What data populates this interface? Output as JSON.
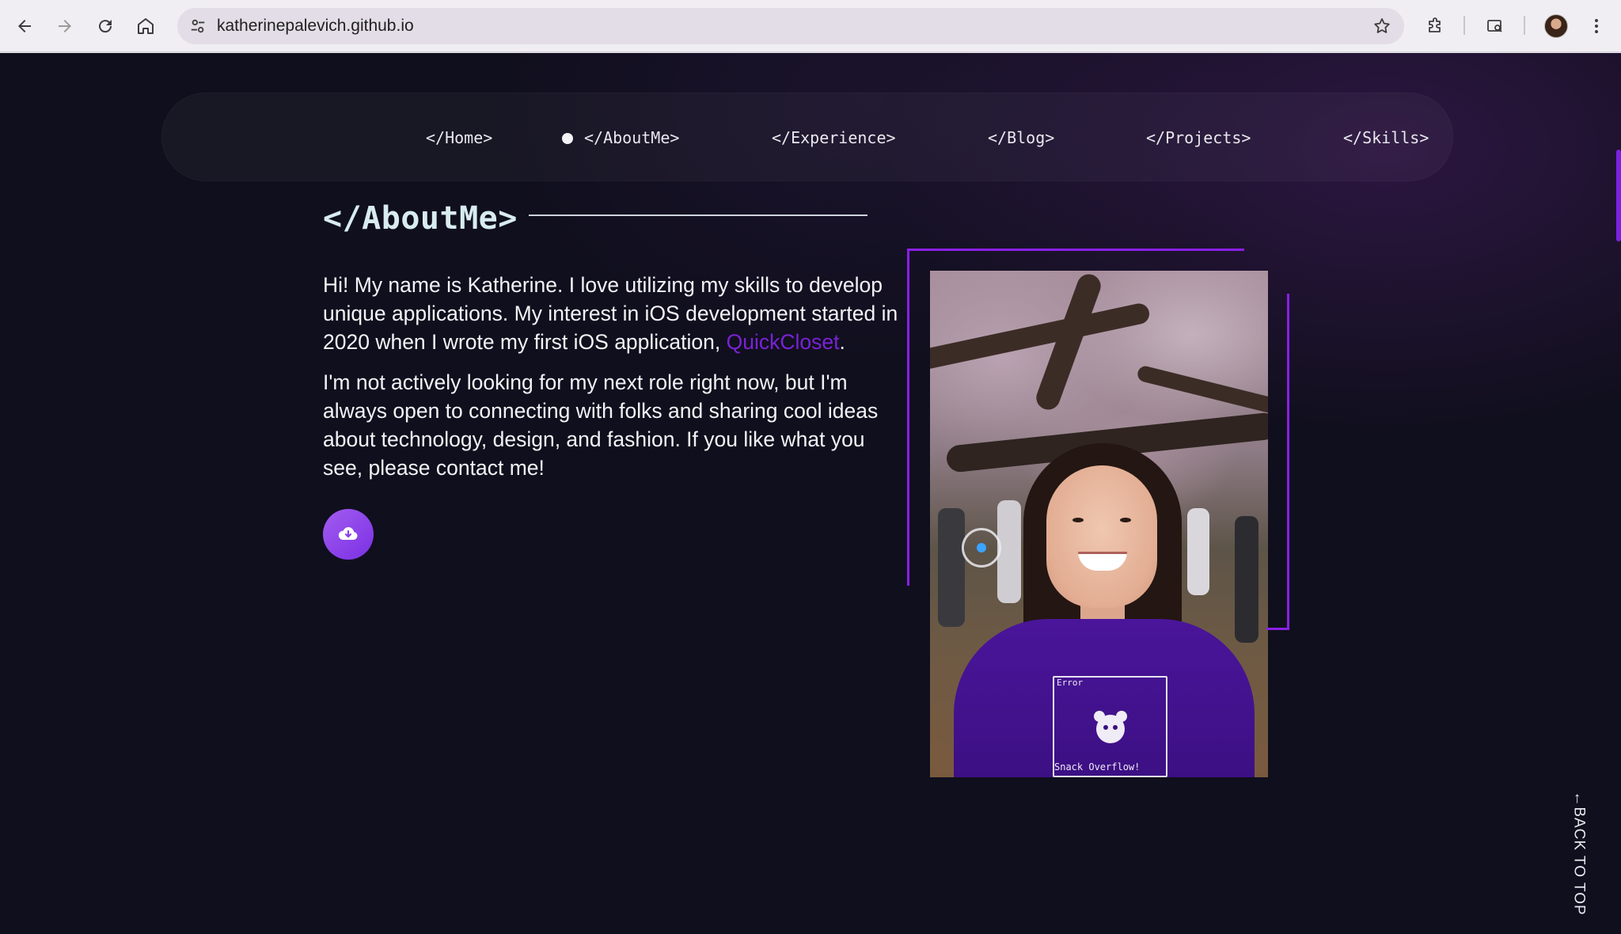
{
  "browser": {
    "url": "katherinepalevich.github.io",
    "icons": [
      "back-icon",
      "forward-icon",
      "reload-icon",
      "home-icon",
      "site-settings-icon",
      "star-icon",
      "extensions-icon",
      "tab-search-icon",
      "profile-avatar",
      "menu-icon"
    ]
  },
  "nav": {
    "items": [
      {
        "label": "</Home>"
      },
      {
        "label": "</AboutMe>",
        "active": true
      },
      {
        "label": "</Experience>"
      },
      {
        "label": "</Blog>"
      },
      {
        "label": "</Projects>"
      },
      {
        "label": "</Skills>"
      }
    ]
  },
  "about": {
    "title": "</AboutMe>",
    "para1_before": "Hi! My name is Katherine. I love utilizing my skills to develop unique applications. My interest in iOS development started in 2020 when I wrote my first iOS application, ",
    "para1_link": "QuickCloset",
    "para1_after": ".",
    "para2": "I'm not actively looking for my next role right now, but I'm always open to connecting with folks and sharing cool ideas about technology, design, and fashion. If you like what you see, please contact me!",
    "resume_icon": "cloud-download-icon"
  },
  "photo": {
    "shirt_label_top": "Error",
    "shirt_label_bottom": "Snack Overflow!"
  },
  "back_to_top": "←BACK TO TOP",
  "colors": {
    "background": "#100f1d",
    "accent": "#8a1fe6",
    "link": "#7a22d6",
    "title": "#d8ecf0"
  }
}
